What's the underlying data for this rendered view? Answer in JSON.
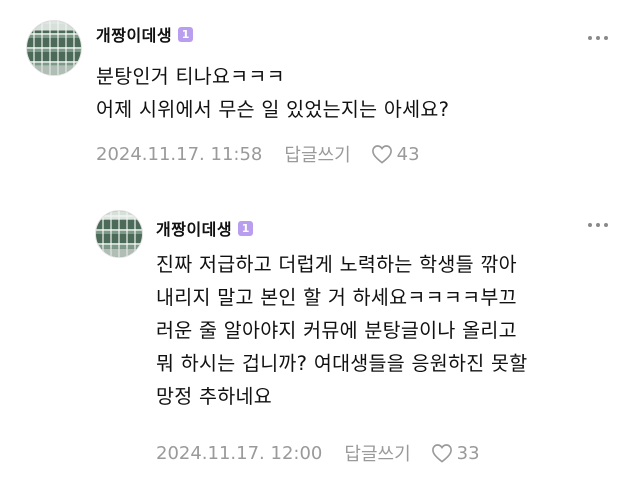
{
  "comments": [
    {
      "username": "개짱이데생",
      "level": "1",
      "lines": [
        "분탕인거 티나요ㅋㅋㅋ",
        "어제 시위에서 무슨 일 있었는지는 아세요?"
      ],
      "date": "2024.11.17. 11:58",
      "reply_label": "답글쓰기",
      "likes": "43"
    },
    {
      "username": "개짱이데생",
      "level": "1",
      "lines": [
        "진짜 저급하고 더럽게 노력하는 학생들 깎아",
        "내리지 말고 본인 할 거 하세요ㅋㅋㅋㅋ부끄",
        "러운 줄 알아야지 커뮤에 분탕글이나 올리고",
        "뭐 하시는 겁니까? 여대생들을 응원하진 못할",
        "망정 추하네요"
      ],
      "date": "2024.11.17. 12:00",
      "reply_label": "답글쓰기",
      "likes": "33"
    }
  ],
  "icons": {
    "more": "more-dots-icon",
    "like": "heart-icon",
    "level": "level-badge-icon"
  },
  "colors": {
    "badge": "#b99ef0",
    "meta": "#9a9a9a"
  }
}
